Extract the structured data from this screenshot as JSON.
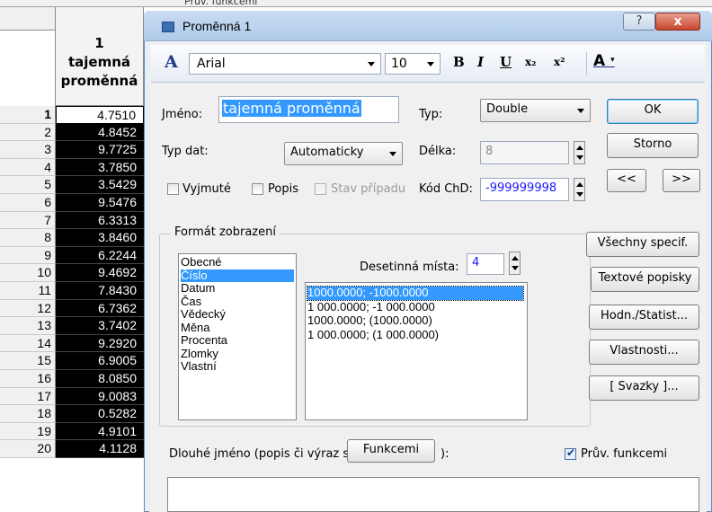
{
  "background_sheet": {
    "top_strip_text": "Prův. funkcemi",
    "column": {
      "number": "1",
      "name_line1": "tajemná",
      "name_line2": "proměnná"
    },
    "rows": [
      {
        "n": "1",
        "v": "4.7510"
      },
      {
        "n": "2",
        "v": "4.8452"
      },
      {
        "n": "3",
        "v": "9.7725"
      },
      {
        "n": "4",
        "v": "3.7850"
      },
      {
        "n": "5",
        "v": "3.5429"
      },
      {
        "n": "6",
        "v": "9.5476"
      },
      {
        "n": "7",
        "v": "6.3313"
      },
      {
        "n": "8",
        "v": "3.8460"
      },
      {
        "n": "9",
        "v": "6.2244"
      },
      {
        "n": "10",
        "v": "9.4692"
      },
      {
        "n": "11",
        "v": "7.8430"
      },
      {
        "n": "12",
        "v": "6.7362"
      },
      {
        "n": "13",
        "v": "3.7402"
      },
      {
        "n": "14",
        "v": "9.2920"
      },
      {
        "n": "15",
        "v": "6.9005"
      },
      {
        "n": "16",
        "v": "8.0850"
      },
      {
        "n": "17",
        "v": "9.0083"
      },
      {
        "n": "18",
        "v": "0.5282"
      },
      {
        "n": "19",
        "v": "4.9101"
      },
      {
        "n": "20",
        "v": "4.1128"
      }
    ]
  },
  "dialog": {
    "title": "Proměnná 1",
    "help_label": "?",
    "close_label": "x",
    "toolbar": {
      "font_icon": "A",
      "font_name": "Arial",
      "font_size": "10",
      "bold": "B",
      "italic": "I",
      "underline": "U",
      "subscript": "x₂",
      "superscript": "x²",
      "font_color": "A"
    },
    "name_label": "Jméno:",
    "name_value": "tajemná proměnná",
    "type_label": "Typ:",
    "type_value": "Double",
    "datatype_label": "Typ dat:",
    "datatype_value": "Automaticky",
    "length_label": "Délka:",
    "length_value": "8",
    "checks": {
      "excluded": "Vyjmuté",
      "label": "Popis",
      "case_state": "Stav případu"
    },
    "md_code_label": "Kód ChD:",
    "md_code_value": "-999999998",
    "buttons": {
      "ok": "OK",
      "cancel": "Storno",
      "prev": "<<",
      "next": ">>",
      "all_specs": "Všechny specif.",
      "text_labels": "Textové popisky",
      "values_stats": "Hodn./Statist...",
      "properties": "Vlastnosti...",
      "links": "[ Svazky ]..."
    },
    "display_format": {
      "title": "Formát zobrazení",
      "categories": [
        "Obecné",
        "Číslo",
        "Datum",
        "Čas",
        "Vědecký",
        "Měna",
        "Procenta",
        "Zlomky",
        "Vlastní"
      ],
      "selected_category": "Číslo",
      "decimals_label": "Desetinná místa:",
      "decimals_value": "4",
      "formats": [
        "1000.0000; -1000.0000",
        "1 000.0000; -1 000.0000",
        "1000.0000; (1000.0000)",
        "1 000.0000; (1 000.0000)"
      ],
      "selected_format": "1000.0000; -1000.0000"
    },
    "long_name_label_prefix": "Dlouhé jméno (popis či výraz s",
    "functions_button": "Funkcemi",
    "long_name_label_suffix": "):",
    "wizard_label": "Prův. funkcemi",
    "wizard_checked": true
  },
  "colors": {
    "selection": "#3399ff",
    "name_highlight": "#3399ff",
    "md_code_text": "#1a1aff",
    "decimals_text": "#1a1aff"
  }
}
